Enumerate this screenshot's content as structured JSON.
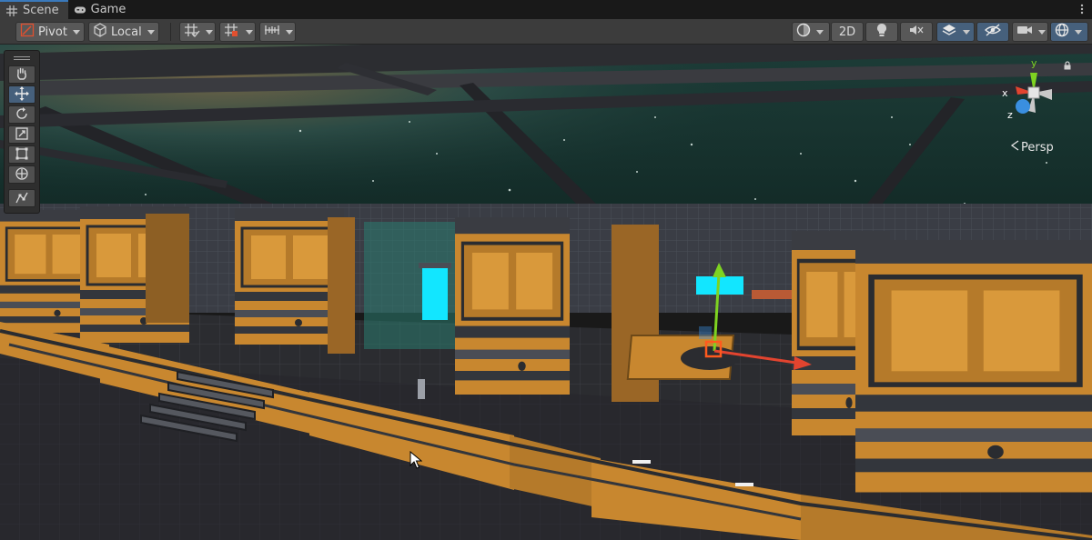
{
  "tabs": [
    {
      "label": "Scene",
      "icon": "grid-icon",
      "active": true
    },
    {
      "label": "Game",
      "icon": "gamepad-icon",
      "active": false
    }
  ],
  "toolbar": {
    "pivot_label": "Pivot",
    "local_label": "Local",
    "mode_2d_label": "2D"
  },
  "gizmo": {
    "axis_y": "y",
    "axis_x": "x",
    "axis_z": "z",
    "projection_label": "Persp"
  },
  "colors": {
    "accent": "#3a79bb",
    "toolbar_bg": "#3c3c3c",
    "button_bg": "#585858",
    "active_button_bg": "#46607c",
    "axis_x": "#e2442f",
    "axis_y": "#7ed321",
    "axis_z": "#3a8fe0",
    "module_orange": "#c8872f",
    "hologram_cyan": "#12e6ff"
  },
  "icons": [
    "grid-icon",
    "gamepad-icon",
    "kebab-menu-icon",
    "pivot-icon",
    "local-cube-icon",
    "grid-snap-icon",
    "increment-snap-icon",
    "ruler-icon",
    "shading-sphere-icon",
    "light-bulb-icon",
    "audio-mute-icon",
    "effects-icon",
    "scene-visibility-icon",
    "camera-icon",
    "gizmos-icon",
    "hand-tool-icon",
    "move-tool-icon",
    "rotate-tool-icon",
    "scale-tool-icon",
    "rect-tool-icon",
    "transform-tool-icon",
    "custom-tool-icon",
    "lock-icon",
    "mouse-cursor-icon"
  ]
}
